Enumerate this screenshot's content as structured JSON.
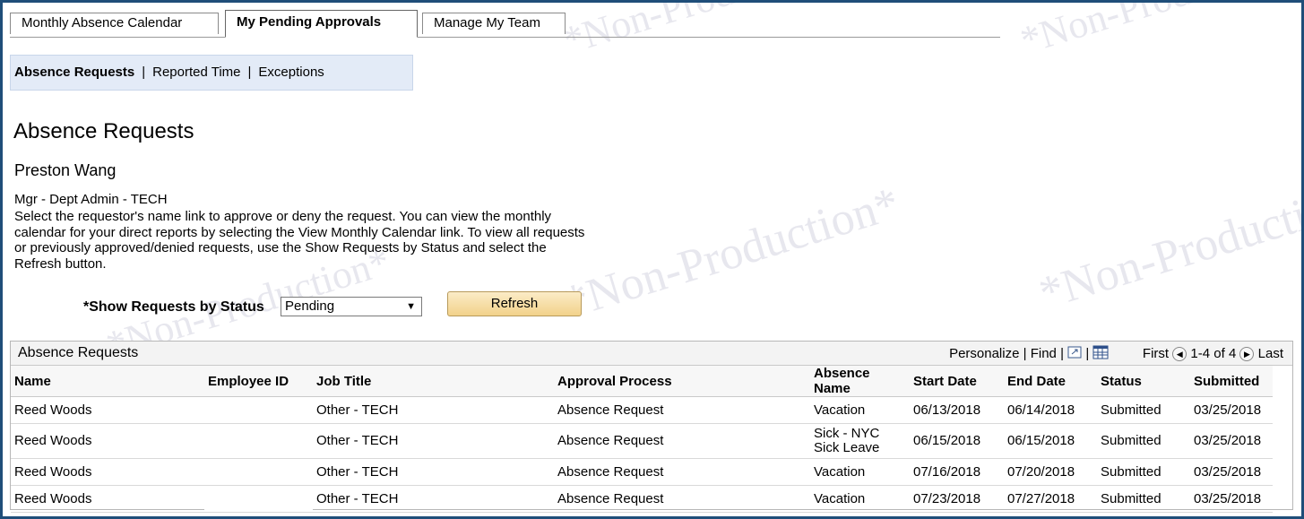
{
  "tabs": [
    "Monthly Absence Calendar",
    "My Pending Approvals",
    "Manage My Team"
  ],
  "subnav": [
    "Absence Requests",
    "Reported Time",
    "Exceptions"
  ],
  "subnav_separator": "|",
  "page_title": "Absence Requests",
  "manager_name": "Preston Wang",
  "manager_role": "Mgr - Dept Admin - TECH",
  "instructions": "Select the requestor's name link to approve or deny the request. You can view the monthly calendar for your direct reports by selecting the View Monthly Calendar link. To view all requests or previously approved/denied requests, use the Show Requests by Status and select the Refresh button.",
  "status_filter": {
    "label": "*Show Requests by Status",
    "value": "Pending"
  },
  "refresh_label": "Refresh",
  "grid": {
    "title": "Absence Requests",
    "personalize": "Personalize",
    "find": "Find",
    "first": "First",
    "range": "1-4 of 4",
    "last": "Last",
    "columns": [
      "Name",
      "Employee ID",
      "Job Title",
      "Approval Process",
      "Absence Name",
      "Start Date",
      "End Date",
      "Status",
      "Submitted"
    ],
    "rows": [
      [
        "Reed Woods",
        "",
        "Other - TECH",
        "Absence Request",
        "Vacation",
        "06/13/2018",
        "06/14/2018",
        "Submitted",
        "03/25/2018"
      ],
      [
        "Reed Woods",
        "",
        "Other - TECH",
        "Absence Request",
        "Sick - NYC Sick Leave",
        "06/15/2018",
        "06/15/2018",
        "Submitted",
        "03/25/2018"
      ],
      [
        "Reed Woods",
        "",
        "Other - TECH",
        "Absence Request",
        "Vacation",
        "07/16/2018",
        "07/20/2018",
        "Submitted",
        "03/25/2018"
      ],
      [
        "Reed Woods",
        "",
        "Other - TECH",
        "Absence Request",
        "Vacation",
        "07/23/2018",
        "07/27/2018",
        "Submitted",
        "03/25/2018"
      ]
    ]
  },
  "icons": {
    "zoom": "zoom-grid-icon",
    "download": "download-grid-icon",
    "prev": "prev-arrow-icon",
    "next": "next-arrow-icon"
  },
  "watermark": "*Non-Production*",
  "colors": {
    "frame": "#1f4e79",
    "subnav_bg": "#e3ebf7",
    "refresh_bg": "#f2d28a"
  }
}
